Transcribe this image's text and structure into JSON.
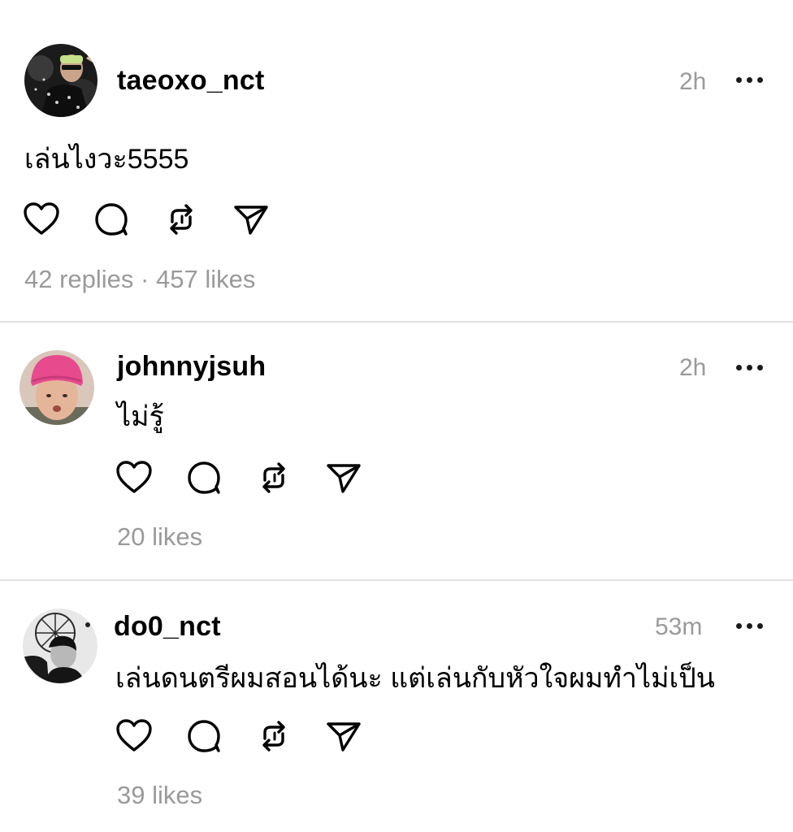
{
  "posts": [
    {
      "username": "taeoxo_nct",
      "time": "2h",
      "text": "เล่นไงวะ5555",
      "replies": "42 replies",
      "separator": " · ",
      "likes": "457 likes"
    },
    {
      "username": "johnnyjsuh",
      "time": "2h",
      "text": "ไม่รู้",
      "likes": "20 likes"
    },
    {
      "username": "do0_nct",
      "time": "53m",
      "text": "เล่นดนตรีผมสอนได้นะ แต่เล่นกับหัวใจผมทำไม่เป็น",
      "likes": "39 likes"
    }
  ],
  "icons": [
    "heart-icon",
    "comment-icon",
    "repost-icon",
    "share-icon",
    "more-icon"
  ],
  "colors": {
    "muted": "#9a9a9a",
    "divider": "#e3e3e3"
  }
}
